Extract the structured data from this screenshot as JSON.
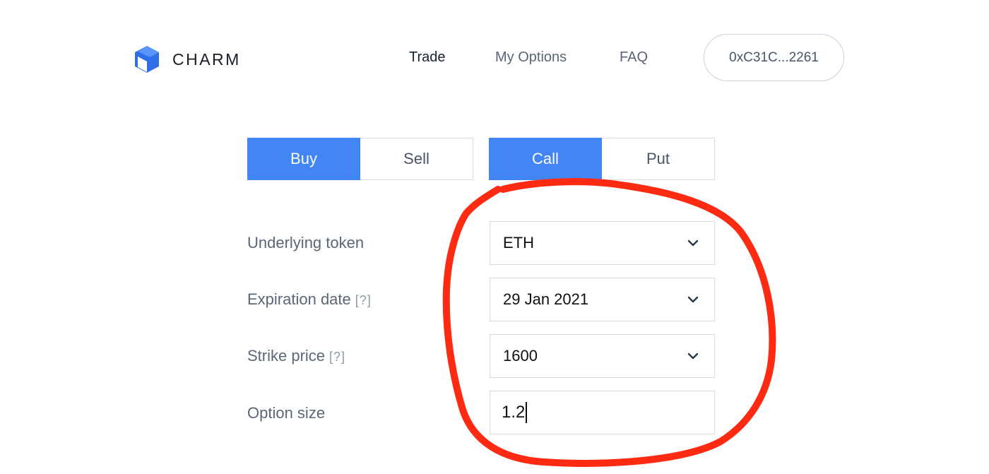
{
  "brand": {
    "name": "CHARM",
    "logo_icon": "cube-icon",
    "logo_color": "#2f6fe8"
  },
  "nav": {
    "trade": "Trade",
    "my_options": "My Options",
    "faq": "FAQ"
  },
  "wallet": {
    "address": "0xC31C...2261"
  },
  "side_toggle": {
    "buy": "Buy",
    "sell": "Sell",
    "selected": "Buy"
  },
  "type_toggle": {
    "call": "Call",
    "put": "Put",
    "selected": "Call"
  },
  "form": {
    "underlying_label": "Underlying token",
    "underlying_value": "ETH",
    "expiration_label": "Expiration date",
    "expiration_help": "[?]",
    "expiration_value": "29 Jan 2021",
    "strike_label": "Strike price",
    "strike_help": "[?]",
    "strike_value": "1600",
    "size_label": "Option size",
    "size_value": "1.2"
  },
  "colors": {
    "accent": "#4286f5",
    "annotation": "#ff2a12"
  }
}
